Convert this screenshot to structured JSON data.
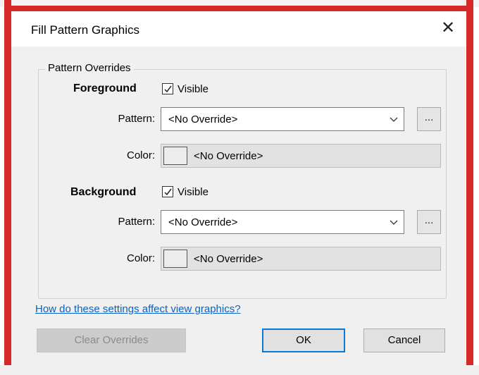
{
  "dialog": {
    "title": "Fill Pattern Graphics",
    "close_glyph": "✕"
  },
  "group": {
    "legend": "Pattern Overrides"
  },
  "foreground": {
    "heading": "Foreground",
    "visible_label": "Visible",
    "visible_checked": true,
    "pattern_label": "Pattern:",
    "pattern_value": "<No Override>",
    "browse_label": "...",
    "color_label": "Color:",
    "color_value": "<No Override>"
  },
  "background": {
    "heading": "Background",
    "visible_label": "Visible",
    "visible_checked": true,
    "pattern_label": "Pattern:",
    "pattern_value": "<No Override>",
    "browse_label": "...",
    "color_label": "Color:",
    "color_value": "<No Override>"
  },
  "help_link": "How do these settings affect view graphics?",
  "buttons": {
    "clear": "Clear Overrides",
    "ok": "OK",
    "cancel": "Cancel"
  },
  "icons": {
    "check": "check-icon",
    "chevron": "chevron-down-icon",
    "close": "close-icon"
  },
  "colors": {
    "frame_red": "#d62a2a",
    "link_blue": "#0a62c4",
    "focus_blue": "#0a78d7"
  }
}
